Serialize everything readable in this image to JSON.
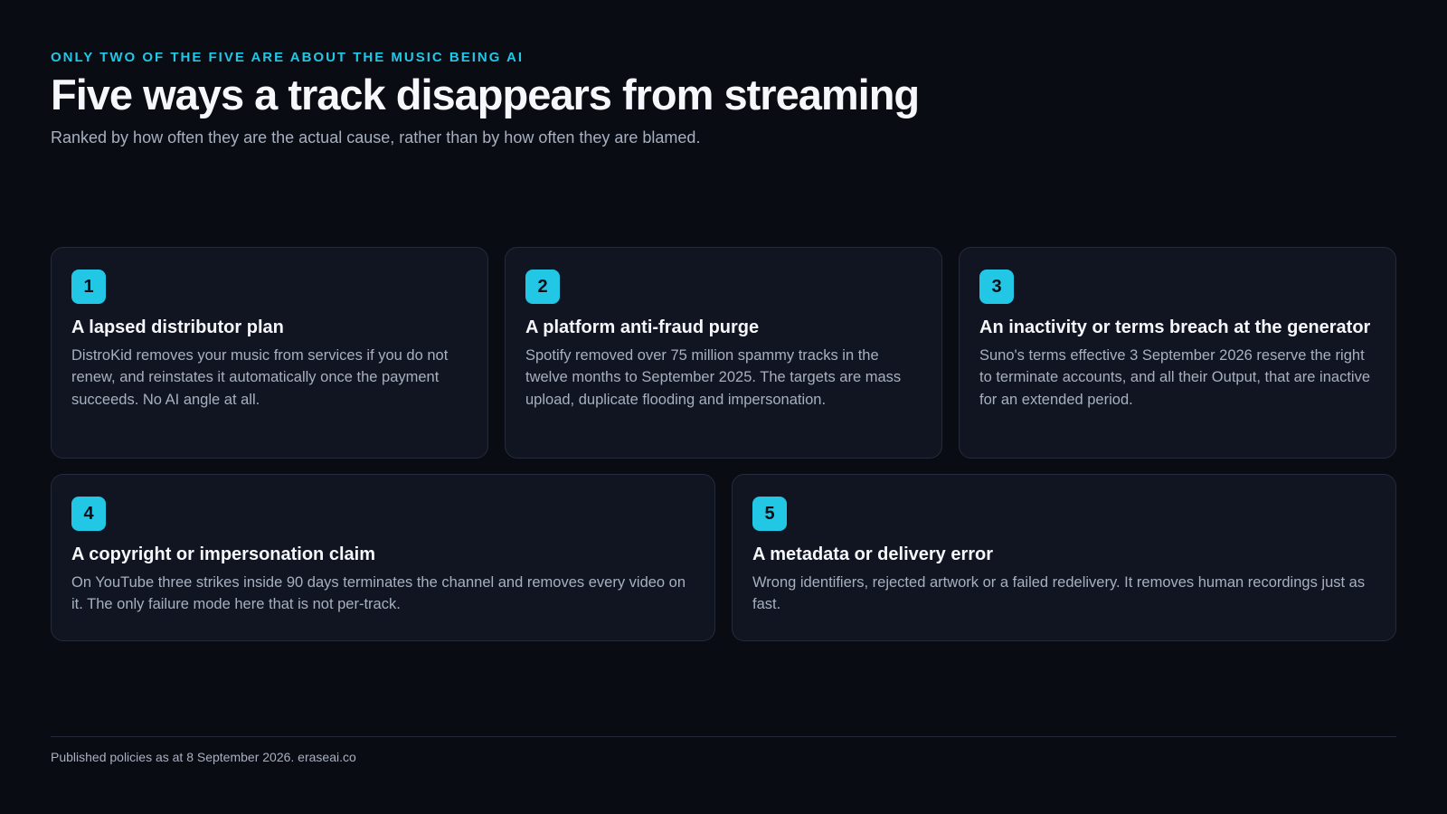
{
  "header": {
    "eyebrow": "ONLY TWO OF THE FIVE ARE ABOUT THE MUSIC BEING AI",
    "title": "Five ways a track disappears from streaming",
    "subtitle": "Ranked by how often they are the actual cause, rather than by how often they are blamed."
  },
  "cards": [
    {
      "number": "1",
      "title": "A lapsed distributor plan",
      "body": "DistroKid removes your music from services if you do not renew, and reinstates it automatically once the payment succeeds. No AI angle at all."
    },
    {
      "number": "2",
      "title": "A platform anti-fraud purge",
      "body": "Spotify removed over 75 million spammy tracks in the twelve months to September 2025. The targets are mass upload, duplicate flooding and impersonation."
    },
    {
      "number": "3",
      "title": "An inactivity or terms breach at the generator",
      "body": "Suno's terms effective 3 September 2026 reserve the right to terminate accounts, and all their Output, that are inactive for an extended period."
    },
    {
      "number": "4",
      "title": "A copyright or impersonation claim",
      "body": "On YouTube three strikes inside 90 days terminates the channel and removes every video on it. The only failure mode here that is not per-track."
    },
    {
      "number": "5",
      "title": "A metadata or delivery error",
      "body": "Wrong identifiers, rejected artwork or a failed redelivery. It removes human recordings just as fast."
    }
  ],
  "footer": {
    "text": "Published policies as at 8 September 2026. eraseai.co"
  },
  "colors": {
    "background": "#0a0c14",
    "card": "#111522",
    "accent": "#22c7e6",
    "text": "#f5f7fa",
    "muted": "#a7b0bf"
  }
}
